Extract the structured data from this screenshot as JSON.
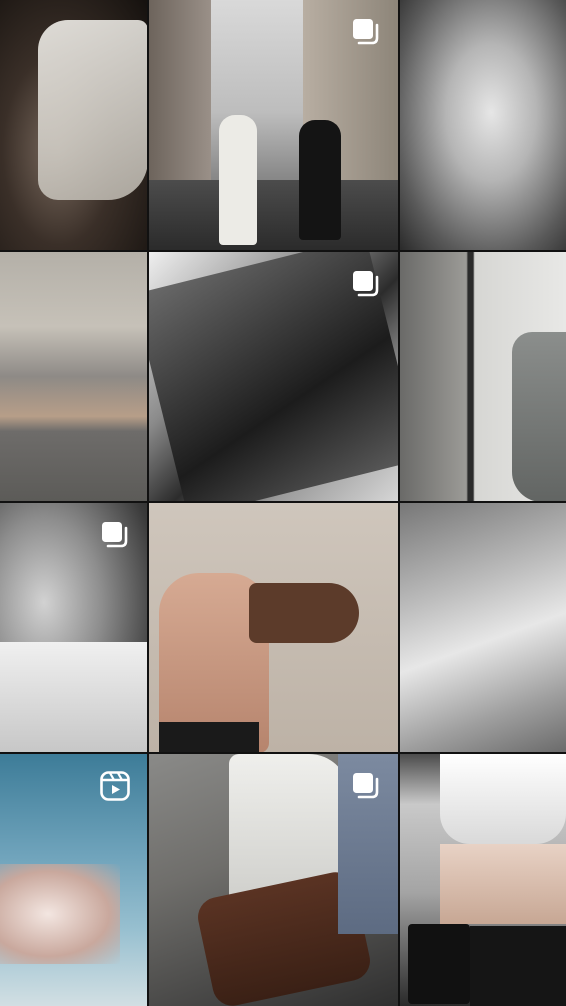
{
  "grid": {
    "columns": 3,
    "background": "#111111",
    "tiles": [
      {
        "id": "post-1",
        "badge": "none"
      },
      {
        "id": "post-2",
        "badge": "carousel"
      },
      {
        "id": "post-3",
        "badge": "none"
      },
      {
        "id": "post-4",
        "badge": "none"
      },
      {
        "id": "post-5",
        "badge": "carousel"
      },
      {
        "id": "post-6",
        "badge": "none"
      },
      {
        "id": "post-7",
        "badge": "carousel"
      },
      {
        "id": "post-8",
        "badge": "none"
      },
      {
        "id": "post-9",
        "badge": "none"
      },
      {
        "id": "post-10",
        "badge": "reel"
      },
      {
        "id": "post-11",
        "badge": "carousel"
      },
      {
        "id": "post-12",
        "badge": "none"
      }
    ]
  },
  "icons": {
    "carousel": "carousel-icon",
    "reel": "reels-icon"
  }
}
